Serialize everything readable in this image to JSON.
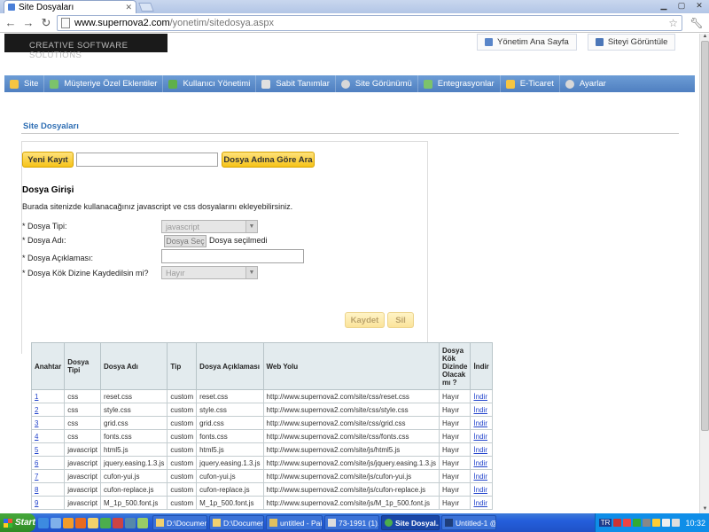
{
  "browser": {
    "tab_title": "Site Dosyaları",
    "url_host": "www.supernova2.com",
    "url_path": "/yonetim/sitedosya.aspx"
  },
  "site": {
    "logo_tagline": "CREATIVE SOFTWARE SOLUTIONS",
    "toplinks": [
      {
        "label": "Yönetim Ana Sayfa",
        "icon": "home-icon"
      },
      {
        "label": "Siteyi Görüntüle",
        "icon": "monitor-icon"
      }
    ],
    "menu": [
      {
        "label": "Site",
        "icon": "star-icon",
        "color": "#f5c542"
      },
      {
        "label": "Müşteriye Özel Eklentiler",
        "icon": "wand-icon",
        "color": "#7cc36b"
      },
      {
        "label": "Kullanıcı Yönetimi",
        "icon": "user-icon",
        "color": "#5fb04a"
      },
      {
        "label": "Sabit Tanımlar",
        "icon": "database-icon",
        "color": "#e0e0e0"
      },
      {
        "label": "Site Görünümü",
        "icon": "gear-icon",
        "color": "#d8d8d8"
      },
      {
        "label": "Entegrasyonlar",
        "icon": "plug-icon",
        "color": "#7cc36b"
      },
      {
        "label": "E-Ticaret",
        "icon": "cart-icon",
        "color": "#f5c542"
      },
      {
        "label": "Ayarlar",
        "icon": "settings-icon",
        "color": "#d8d8d8"
      }
    ]
  },
  "main": {
    "section_title": "Site Dosyaları",
    "new_button": "Yeni Kayıt",
    "search_value": "",
    "search_button": "Dosya Adına Göre Ara",
    "form": {
      "title": "Dosya Girişi",
      "description": "Burada sitenizde kullanacağınız javascript ve css dosyalarını ekleyebilirsiniz.",
      "type_label": "* Dosya Tipi:",
      "type_value": "javascript",
      "name_label": "* Dosya Adı:",
      "file_button": "Dosya Seç",
      "file_status": "Dosya seçilmedi",
      "desc_label": "* Dosya Açıklaması:",
      "root_label": "* Dosya Kök Dizine Kaydedilsin mi?",
      "root_value": "Hayır",
      "save_button": "Kaydet",
      "delete_button": "Sil"
    },
    "table": {
      "headers": [
        "Anahtar",
        "Dosya Tipi",
        "Dosya Adı",
        "Tip",
        "Dosya Açıklaması",
        "Web Yolu",
        "Dosya Kök Dizinde Olacak mı ?",
        "İndir"
      ],
      "rows": [
        [
          "1",
          "css",
          "reset.css",
          "custom",
          "reset.css",
          "http://www.supernova2.com/site/css/reset.css",
          "Hayır",
          "İndir"
        ],
        [
          "2",
          "css",
          "style.css",
          "custom",
          "style.css",
          "http://www.supernova2.com/site/css/style.css",
          "Hayır",
          "İndir"
        ],
        [
          "3",
          "css",
          "grid.css",
          "custom",
          "grid.css",
          "http://www.supernova2.com/site/css/grid.css",
          "Hayır",
          "İndir"
        ],
        [
          "4",
          "css",
          "fonts.css",
          "custom",
          "fonts.css",
          "http://www.supernova2.com/site/css/fonts.css",
          "Hayır",
          "İndir"
        ],
        [
          "5",
          "javascript",
          "html5.js",
          "custom",
          "html5.js",
          "http://www.supernova2.com/site/js/html5.js",
          "Hayır",
          "İndir"
        ],
        [
          "6",
          "javascript",
          "jquery.easing.1.3.js",
          "custom",
          "jquery.easing.1.3.js",
          "http://www.supernova2.com/site/js/jquery.easing.1.3.js",
          "Hayır",
          "İndir"
        ],
        [
          "7",
          "javascript",
          "cufon-yui.js",
          "custom",
          "cufon-yui.js",
          "http://www.supernova2.com/site/js/cufon-yui.js",
          "Hayır",
          "İndir"
        ],
        [
          "8",
          "javascript",
          "cufon-replace.js",
          "custom",
          "cufon-replace.js",
          "http://www.supernova2.com/site/js/cufon-replace.js",
          "Hayır",
          "İndir"
        ],
        [
          "9",
          "javascript",
          "M_1p_500.font.js",
          "custom",
          "M_1p_500.font.js",
          "http://www.supernova2.com/site/js/M_1p_500.font.js",
          "Hayır",
          "İndir"
        ]
      ]
    }
  },
  "taskbar": {
    "start": "Start",
    "buttons": [
      {
        "label": "D:\\Documen...",
        "active": false
      },
      {
        "label": "D:\\Documen...",
        "active": false
      },
      {
        "label": "untitled - Paint",
        "active": false
      },
      {
        "label": "73-1991 (1)...",
        "active": false
      },
      {
        "label": "Site Dosyal...",
        "active": true
      },
      {
        "label": "Untitled-1 @...",
        "active": false
      }
    ],
    "lang": "TR",
    "clock": "10:32"
  }
}
